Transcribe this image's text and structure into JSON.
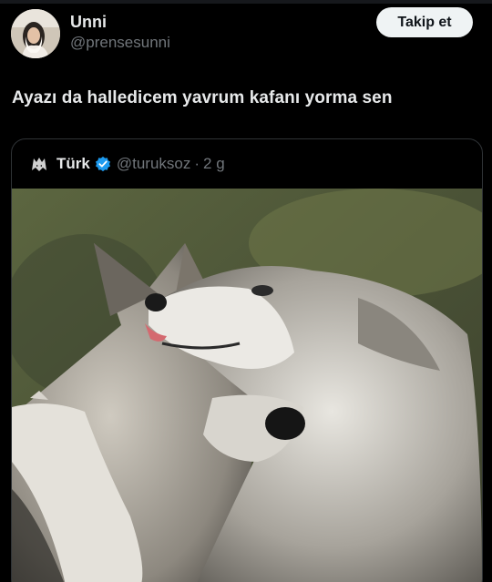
{
  "author": {
    "display_name": "Unni",
    "handle": "@prensesunni",
    "avatar_icon": "profile-photo"
  },
  "follow_button": {
    "label": "Takip et"
  },
  "tweet": {
    "text": "Ayazı da halledicem yavrum kafanı yorma sen"
  },
  "quoted": {
    "display_name": "Türk",
    "handle": "@turuksoz",
    "separator": "·",
    "time": "2 g",
    "verified_icon": "verified-badge-icon",
    "avatar_icon": "wolf-logo-icon",
    "media_description_icon": "wolves-photo"
  },
  "colors": {
    "background": "#000000",
    "text": "#e7e9ea",
    "muted": "#71767b",
    "border": "#2f3336",
    "verified": "#1d9bf0",
    "button_bg": "#eff3f4"
  }
}
